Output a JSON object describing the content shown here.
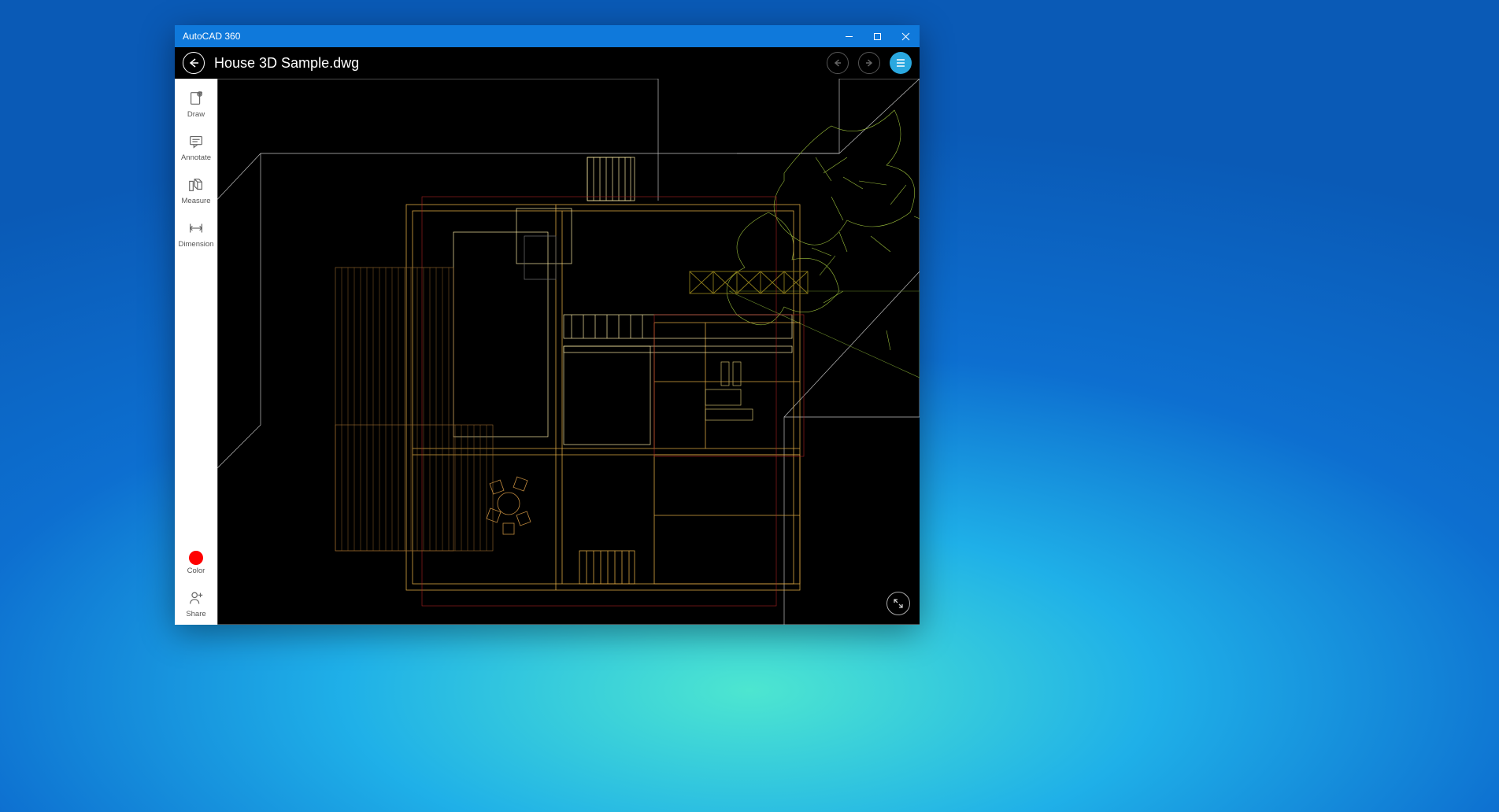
{
  "window": {
    "app_title": "AutoCAD 360"
  },
  "header": {
    "document_title": "House 3D Sample.dwg"
  },
  "sidebar": {
    "draw_label": "Draw",
    "annotate_label": "Annotate",
    "measure_label": "Measure",
    "dimension_label": "Dimension",
    "color_label": "Color",
    "share_label": "Share",
    "current_color": "#ff0000"
  },
  "icons": {
    "back": "back-arrow",
    "undo": "undo",
    "redo": "redo",
    "menu": "hamburger",
    "draw": "pencil-clipboard",
    "annotate": "speech-bubble",
    "measure": "ruler-cube",
    "dimension": "dimension-arrows",
    "share": "person-plus",
    "expand": "expand-arrows"
  }
}
